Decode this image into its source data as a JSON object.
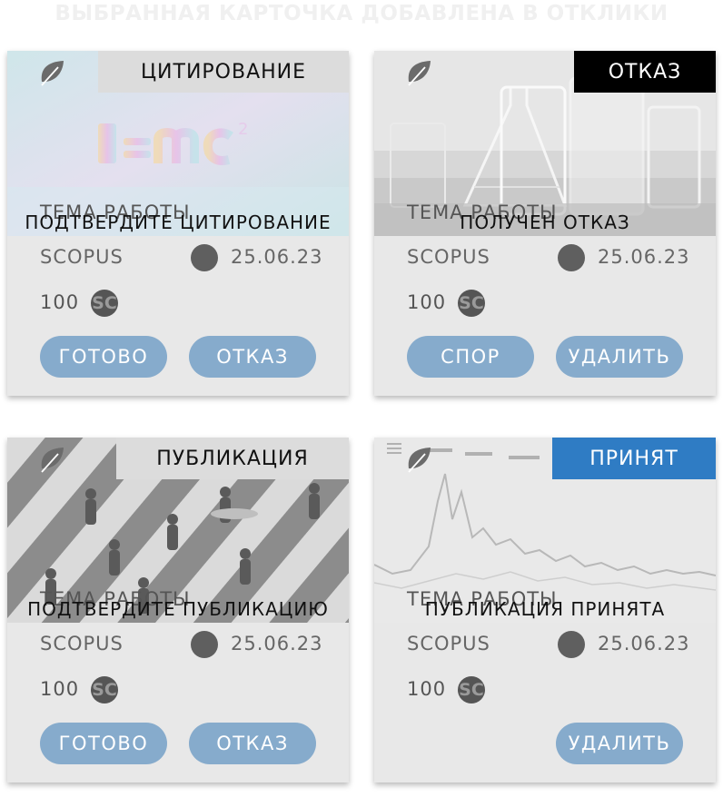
{
  "header": {
    "title": "ВЫБРАННАЯ КАРТОЧКА ДОБАВЛЕНА В ОТКЛИКИ"
  },
  "colors": {
    "card_bg": "#e8e8e8",
    "button_bg": "#86abcc",
    "badge_refusal": "#000000",
    "badge_accepted": "#2f7cc4",
    "badge_neutral": "#dcdcdc"
  },
  "cards": [
    {
      "badge": "ЦИТИРОВАНИЕ",
      "image": "emc2-formula-image",
      "icon": "leaf-icon",
      "topic": "ТЕМА РАБОТЫ",
      "status": "ПОДТВЕРДИТЕ ЦИТИРОВАНИЕ",
      "source": "SCOPUS",
      "date": "25.06.23",
      "points": "100",
      "currency": "SC",
      "buttons": [
        "ГОТОВО",
        "ОТКАЗ"
      ]
    },
    {
      "badge": "ОТКАЗ",
      "image": "lab-glassware-image",
      "icon": "leaf-icon",
      "topic": "ТЕМА РАБОТЫ",
      "status": "ПОЛУЧЕН ОТКАЗ",
      "source": "SCOPUS",
      "date": "25.06.23",
      "points": "100",
      "currency": "SC",
      "buttons": [
        "СПОР",
        "УДАЛИТЬ"
      ]
    },
    {
      "badge": "ПУБЛИКАЦИЯ",
      "image": "crosswalk-image",
      "icon": "leaf-icon",
      "topic": "ТЕМА РАБОТЫ",
      "status": "ПОДТВЕРДИТЕ ПУБЛИКАЦИЮ",
      "source": "SCOPUS",
      "date": "25.06.23",
      "points": "100",
      "currency": "SC",
      "buttons": [
        "ГОТОВО",
        "ОТКАЗ"
      ]
    },
    {
      "badge": "ПРИНЯТ",
      "image": "stock-chart-image",
      "icon": "leaf-icon",
      "topic": "ТЕМА РАБОТЫ",
      "status": "ПУБЛИКАЦИЯ ПРИНЯТА",
      "source": "SCOPUS",
      "date": "25.06.23",
      "points": "100",
      "currency": "SC",
      "buttons": [
        "УДАЛИТЬ"
      ]
    }
  ]
}
